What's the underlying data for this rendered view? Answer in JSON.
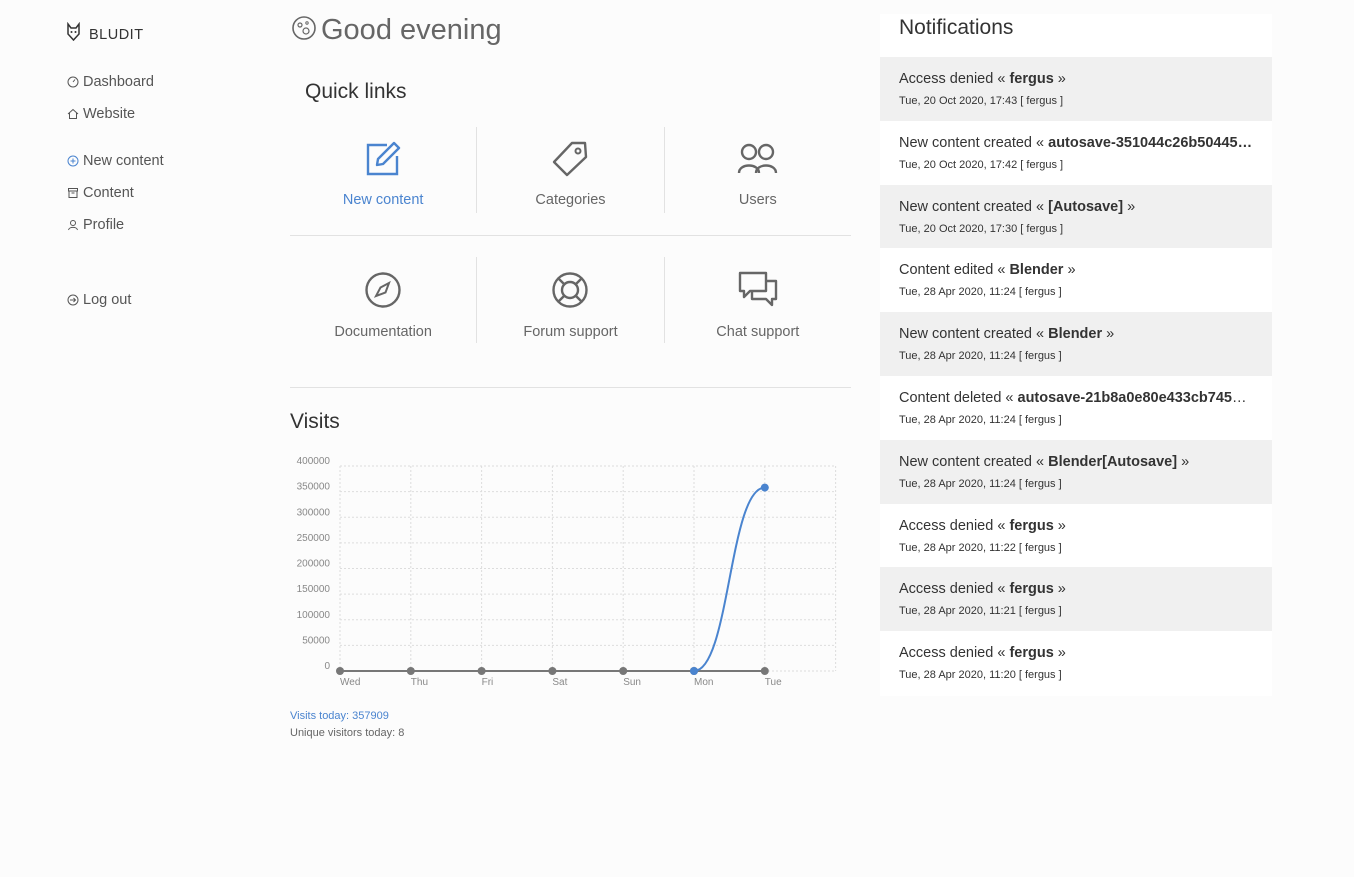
{
  "sidebar": {
    "brand": "BLUDIT",
    "items": [
      {
        "label": "Dashboard",
        "icon": "dashboard-icon"
      },
      {
        "label": "Website",
        "icon": "home-icon"
      },
      {
        "label": "New content",
        "icon": "plus-circle-icon"
      },
      {
        "label": "Content",
        "icon": "archive-icon"
      },
      {
        "label": "Profile",
        "icon": "user-icon"
      },
      {
        "label": "Log out",
        "icon": "logout-icon"
      }
    ]
  },
  "greeting": "Good evening",
  "quick_links": {
    "title": "Quick links",
    "items": [
      {
        "label": "New content",
        "icon": "edit-icon"
      },
      {
        "label": "Categories",
        "icon": "tag-icon"
      },
      {
        "label": "Users",
        "icon": "users-icon"
      },
      {
        "label": "Documentation",
        "icon": "compass-icon"
      },
      {
        "label": "Forum support",
        "icon": "lifebuoy-icon"
      },
      {
        "label": "Chat support",
        "icon": "chat-icon"
      }
    ]
  },
  "visits": {
    "title": "Visits",
    "today_label": "Visits today: 357909",
    "unique_label": "Unique visitors today: 8"
  },
  "chart_data": {
    "type": "line",
    "title": "",
    "xlabel": "",
    "ylabel": "",
    "categories": [
      "Wed",
      "Thu",
      "Fri",
      "Sat",
      "Sun",
      "Mon",
      "Tue"
    ],
    "yticks": [
      "400000",
      "350000",
      "300000",
      "250000",
      "200000",
      "150000",
      "100000",
      "50000",
      "0"
    ],
    "ylim": [
      0,
      400000
    ],
    "grid": true,
    "series": [
      {
        "values": [
          0,
          0,
          0,
          0,
          0,
          0,
          0
        ],
        "color": "#777777"
      },
      {
        "values": [
          null,
          null,
          null,
          null,
          null,
          0,
          357909
        ],
        "color": "#4a84cf"
      }
    ]
  },
  "notifications": {
    "title": "Notifications",
    "items": [
      {
        "text": "Access denied « ",
        "bold": "fergus",
        "tail": " »",
        "date": "Tue, 20 Oct 2020, 17:43 [ fergus ]"
      },
      {
        "text": "New content created « ",
        "bold": "autosave-351044c26b50445…",
        "tail": "",
        "date": "Tue, 20 Oct 2020, 17:42 [ fergus ]"
      },
      {
        "text": "New content created « ",
        "bold": "[Autosave]",
        "tail": " »",
        "date": "Tue, 20 Oct 2020, 17:30 [ fergus ]"
      },
      {
        "text": "Content edited « ",
        "bold": "Blender",
        "tail": " »",
        "date": "Tue, 28 Apr 2020, 11:24 [ fergus ]"
      },
      {
        "text": "New content created « ",
        "bold": "Blender",
        "tail": " »",
        "date": "Tue, 28 Apr 2020, 11:24 [ fergus ]"
      },
      {
        "text": "Content deleted « ",
        "bold": "autosave-21b8a0e80e433cb7453…",
        "tail": "",
        "date": "Tue, 28 Apr 2020, 11:24 [ fergus ]"
      },
      {
        "text": "New content created « ",
        "bold": "Blender[Autosave]",
        "tail": " »",
        "date": "Tue, 28 Apr 2020, 11:24 [ fergus ]"
      },
      {
        "text": "Access denied « ",
        "bold": "fergus",
        "tail": " »",
        "date": "Tue, 28 Apr 2020, 11:22 [ fergus ]"
      },
      {
        "text": "Access denied « ",
        "bold": "fergus",
        "tail": " »",
        "date": "Tue, 28 Apr 2020, 11:21 [ fergus ]"
      },
      {
        "text": "Access denied « ",
        "bold": "fergus",
        "tail": " »",
        "date": "Tue, 28 Apr 2020, 11:20 [ fergus ]"
      }
    ]
  }
}
